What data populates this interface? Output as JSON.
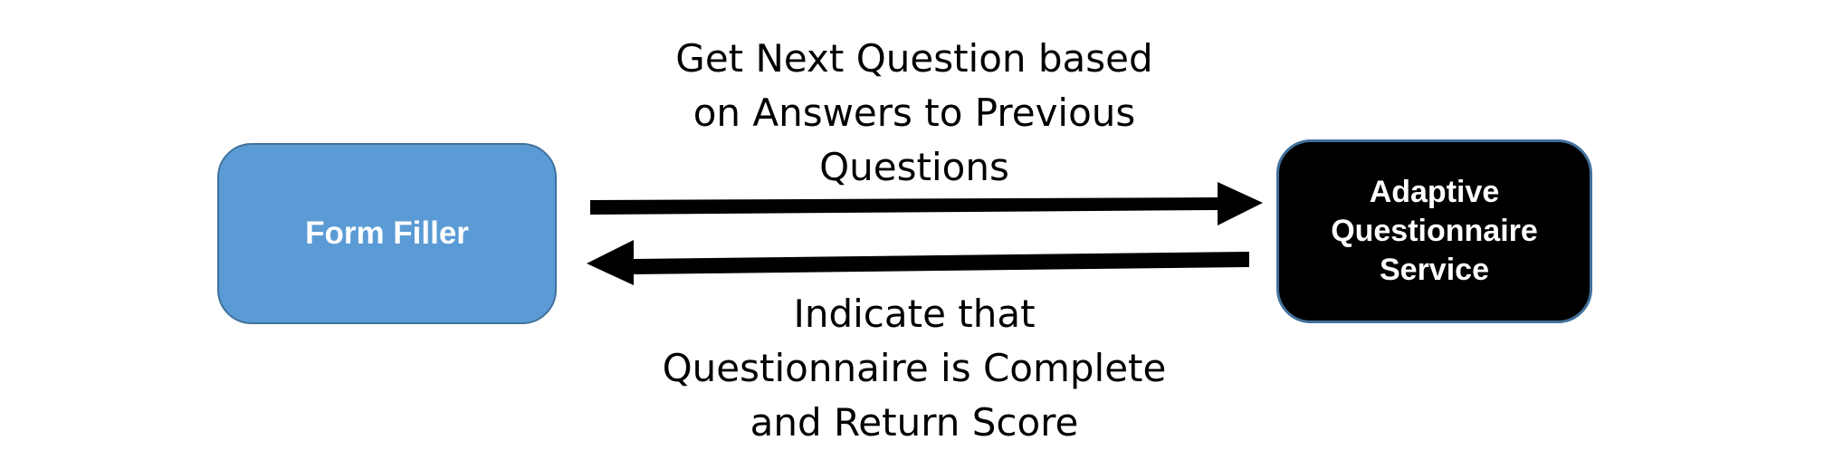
{
  "nodes": {
    "form_filler": {
      "label": "Form Filler",
      "color": "#5b9bd5"
    },
    "service": {
      "label_lines": [
        "Adaptive",
        "Questionnaire",
        "Service"
      ],
      "color": "#000000"
    }
  },
  "edges": {
    "request": {
      "from": "Form Filler",
      "to": "Adaptive Questionnaire Service",
      "label_lines": [
        "Get Next Question based",
        "on Answers to Previous",
        "Questions"
      ]
    },
    "response": {
      "from": "Adaptive Questionnaire Service",
      "to": "Form Filler",
      "label_lines": [
        "Indicate that",
        "Questionnaire is Complete",
        "and Return Score"
      ]
    }
  }
}
